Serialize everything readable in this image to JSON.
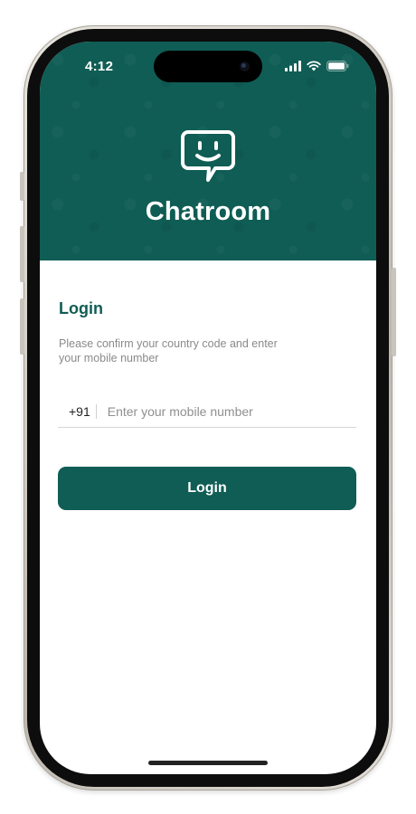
{
  "status_bar": {
    "time": "4:12",
    "icons": [
      "cellular-signal-icon",
      "wifi-icon",
      "battery-icon"
    ]
  },
  "header": {
    "app_name": "Chatroom",
    "logo_icon": "smiley-chat-bubble-icon",
    "background_color": "#0f5d55"
  },
  "login": {
    "title": "Login",
    "subtitle": "Please confirm your country code and enter your mobile number",
    "country_code": "+91",
    "mobile_placeholder": "Enter your mobile number",
    "mobile_value": "",
    "button_label": "Login"
  },
  "colors": {
    "accent": "#0f5d55",
    "muted_text": "#8a8a8a",
    "white": "#ffffff"
  }
}
